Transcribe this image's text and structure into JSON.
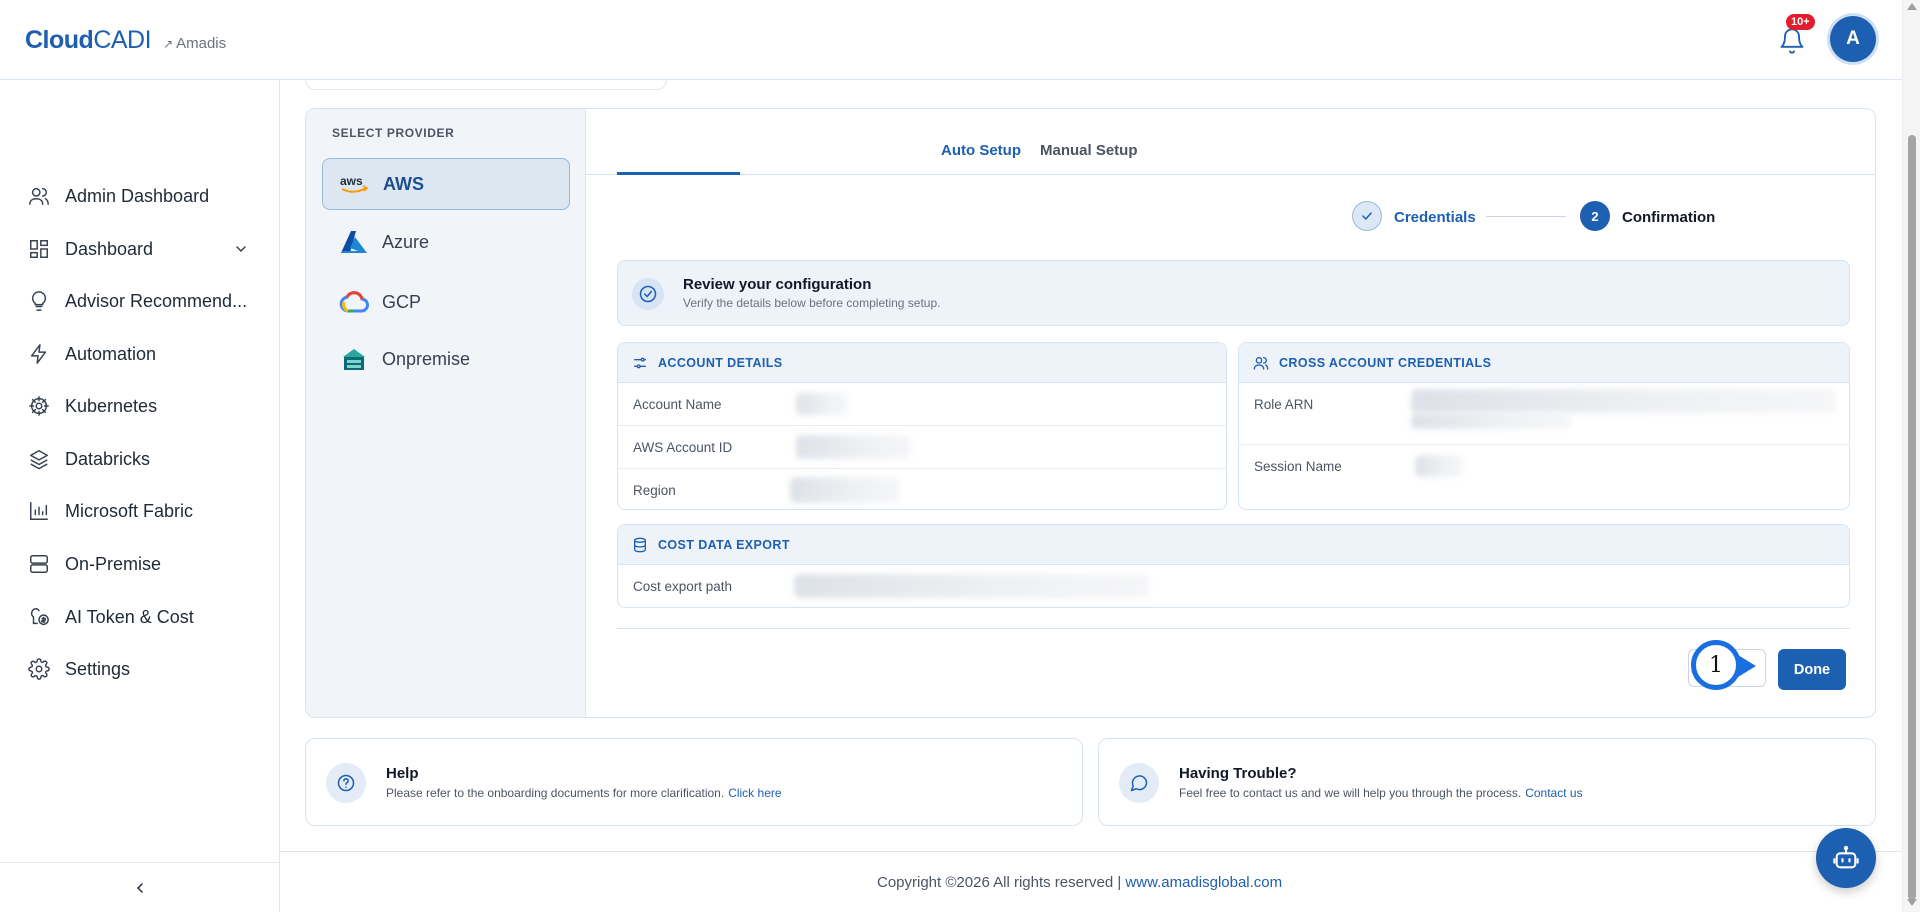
{
  "brand": {
    "name_bold": "Cloud",
    "name_light": "CADI",
    "org": "Amadis"
  },
  "header": {
    "notification_badge": "10+",
    "avatar_initial": "A"
  },
  "sidebar": {
    "items": [
      {
        "label": "Admin Dashboard",
        "icon": "users-icon"
      },
      {
        "label": "Dashboard",
        "icon": "dashboard-icon",
        "expandable": true
      },
      {
        "label": "Advisor Recommend...",
        "icon": "lightbulb-icon"
      },
      {
        "label": "Automation",
        "icon": "lightning-icon"
      },
      {
        "label": "Kubernetes",
        "icon": "helm-icon"
      },
      {
        "label": "Databricks",
        "icon": "layers-icon"
      },
      {
        "label": "Microsoft Fabric",
        "icon": "bar-chart-icon"
      },
      {
        "label": "On-Premise",
        "icon": "server-icon"
      },
      {
        "label": "AI Token & Cost",
        "icon": "ai-cost-icon"
      },
      {
        "label": "Settings",
        "icon": "gear-icon"
      }
    ],
    "collapse_icon": "chevron-left-icon"
  },
  "providers": {
    "title": "SELECT PROVIDER",
    "items": [
      {
        "label": "AWS",
        "active": true
      },
      {
        "label": "Azure",
        "active": false
      },
      {
        "label": "GCP",
        "active": false
      },
      {
        "label": "Onpremise",
        "active": false
      }
    ]
  },
  "tabs": [
    {
      "label": "Auto Setup",
      "active": true
    },
    {
      "label": "Manual Setup",
      "active": false
    }
  ],
  "stepper": {
    "steps": [
      {
        "label": "Credentials",
        "state": "completed"
      },
      {
        "label": "Confirmation",
        "number": "2",
        "state": "current"
      }
    ]
  },
  "review": {
    "title": "Review your configuration",
    "subtitle": "Verify the details below before completing setup."
  },
  "account_details": {
    "title": "ACCOUNT DETAILS",
    "rows": [
      {
        "label": "Account Name"
      },
      {
        "label": "AWS Account ID"
      },
      {
        "label": "Region"
      }
    ]
  },
  "cross_account": {
    "title": "CROSS ACCOUNT CREDENTIALS",
    "rows": [
      {
        "label": "Role ARN"
      },
      {
        "label": "Session Name"
      }
    ]
  },
  "cost_export": {
    "title": "COST DATA EXPORT",
    "rows": [
      {
        "label": "Cost export path"
      }
    ]
  },
  "actions": {
    "step_marker": "1",
    "done_label": "Done"
  },
  "help": {
    "title": "Help",
    "text": "Please refer to the onboarding documents for more clarification.",
    "link": "Click here"
  },
  "trouble": {
    "title": "Having Trouble?",
    "text": "Feel free to contact us and we will help you through the process.",
    "link": "Contact us"
  },
  "footer": {
    "copyright": "Copyright ©2026 All rights reserved |",
    "link": "www.amadisglobal.com"
  },
  "colors": {
    "primary": "#1d5fb0",
    "badge": "#e11d2e",
    "marker": "#1a6fe0"
  }
}
